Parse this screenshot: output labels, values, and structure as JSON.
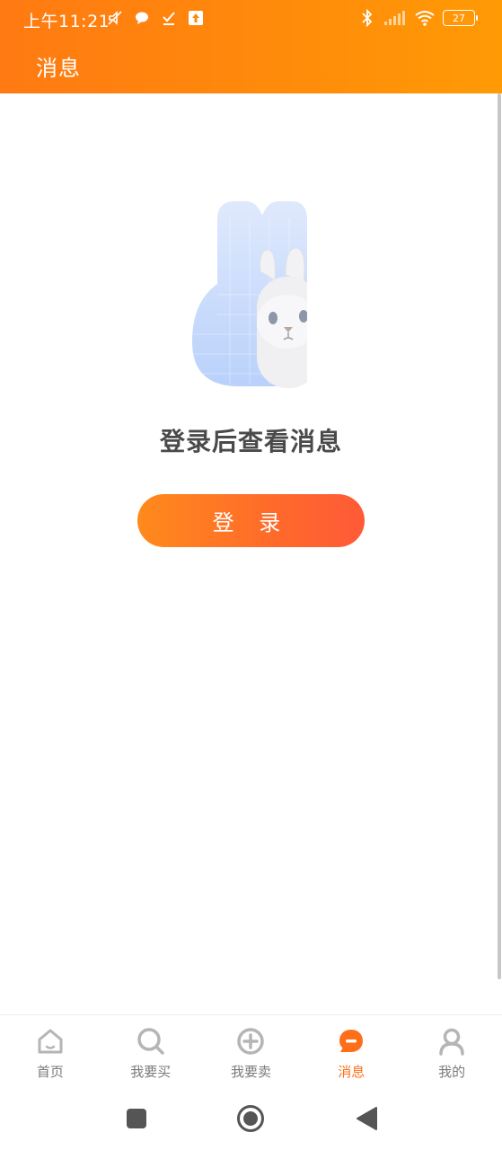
{
  "status_bar": {
    "time": "上午11:21",
    "battery": "27",
    "left_icons": [
      "mute-icon",
      "chat-bubble-icon",
      "check-icon",
      "upload-icon"
    ],
    "right_icons": [
      "bluetooth-icon",
      "signal-icon",
      "wifi-icon",
      "battery-icon"
    ]
  },
  "header": {
    "title": "消息",
    "gradient_start": "#ff7a12",
    "gradient_end": "#ff9a05"
  },
  "main": {
    "empty_message": "登录后查看消息",
    "login_button": "登 录",
    "illustration": "rabbit-illustration"
  },
  "tabbar": {
    "active_color": "#ff6f1a",
    "inactive_color": "#7a7a7a",
    "items": [
      {
        "label": "首页",
        "icon": "home-icon"
      },
      {
        "label": "我要买",
        "icon": "search-icon"
      },
      {
        "label": "我要卖",
        "icon": "plus-circle-icon"
      },
      {
        "label": "消息",
        "icon": "message-icon",
        "active": true
      },
      {
        "label": "我的",
        "icon": "user-icon"
      }
    ]
  },
  "system_nav": {
    "icons": [
      "recents-icon",
      "home-circle-icon",
      "back-icon"
    ]
  }
}
